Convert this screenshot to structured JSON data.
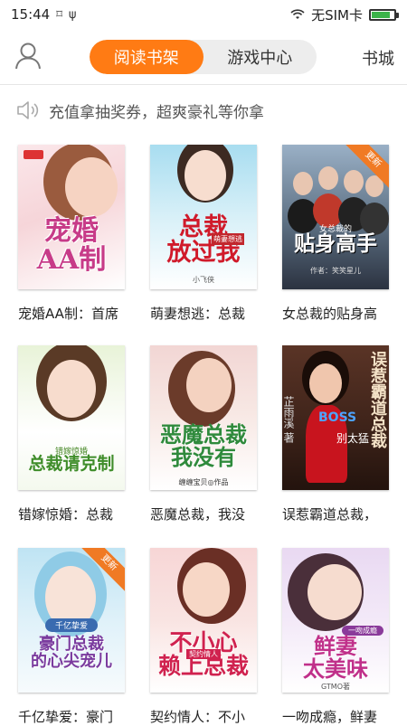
{
  "status_bar": {
    "time": "15:44",
    "carrier": "无SIM卡",
    "battery_level": 0.85
  },
  "header": {
    "tabs": [
      {
        "label": "阅读书架",
        "active": true
      },
      {
        "label": "游戏中心",
        "active": false
      }
    ],
    "store_label": "书城"
  },
  "notice": {
    "text": "充值拿抽奖券，超爽豪礼等你拿"
  },
  "books": [
    {
      "title": "宠婚AA制：首席",
      "cover_text": "宠婚\nAA制",
      "ribbon": ""
    },
    {
      "title": "萌妻想逃：总裁",
      "cover_text": "总裁\n放过我",
      "cover_tag": "萌妻想逃",
      "author": "小飞侠",
      "ribbon": ""
    },
    {
      "title": "女总裁的贴身高",
      "cover_text": "贴身高手",
      "cover_tag": "女总裁的",
      "author": "作者：笑笑星儿",
      "ribbon": "更新"
    },
    {
      "title": "错嫁惊婚：总裁",
      "cover_text": "总裁请克制",
      "cover_tag": "错嫁惊婚",
      "ribbon": ""
    },
    {
      "title": "恶魔总裁，我没",
      "cover_text": "恶魔总裁\n我没有",
      "author": "缠缠宝贝◎作品",
      "ribbon": ""
    },
    {
      "title": "误惹霸道总裁，",
      "cover_text": "误惹\n霸道总裁",
      "cover_tag": "BOSS",
      "cover_tag2": "别太猛",
      "author": "芷雨溪 著",
      "ribbon": ""
    },
    {
      "title": "千亿挚爱：豪门",
      "cover_text": "豪门总裁\n的心尖宠儿",
      "cover_tag": "千亿挚爱",
      "ribbon": "更新"
    },
    {
      "title": "契约情人：不小",
      "cover_text": "不小心\n赖上总裁",
      "cover_tag": "契约情人",
      "ribbon": ""
    },
    {
      "title": "一吻成瘾，鲜妻",
      "cover_text": "鲜妻\n太美味",
      "cover_tag": "一吻成瘾",
      "author": "GTMO著",
      "ribbon": ""
    }
  ]
}
